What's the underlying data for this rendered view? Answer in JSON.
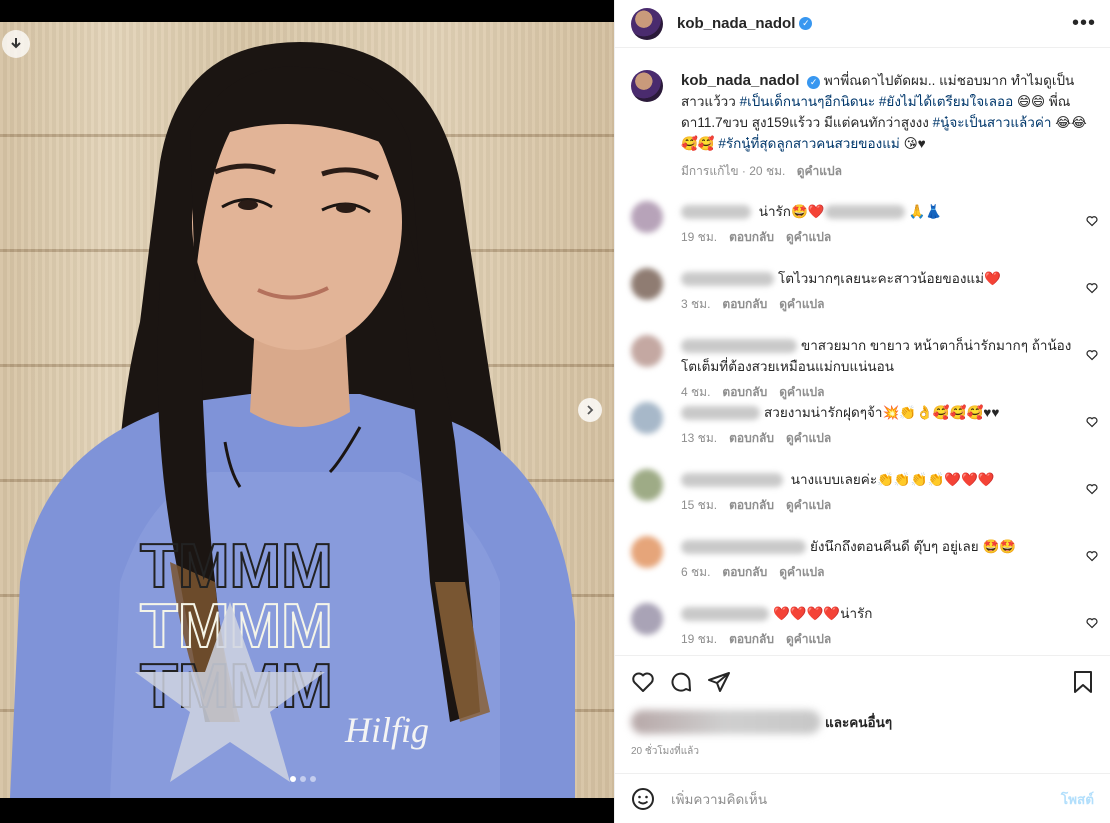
{
  "post": {
    "username": "kob_nada_nadol",
    "caption_text": "พาพี่ณดาไปตัดผม.. แม่ชอบมาก ทำไมดูเป็นสาวแว้วว ",
    "caption_tag1": "#เป็นเด็กนานๆอีกนิดนะ",
    "caption_tag2": "#ยังไม่ได้เตรียมใจเลออ",
    "caption_mid": " 😄😄 พี่ณดา11.7ขวบ สูง159แร้วว มีแต่คนทักว่าสูงงง ",
    "caption_tag3": "#นู๋จะเป็นสาวแล้วค่า",
    "caption_mid2": " 😂😂 🥰🥰 ",
    "caption_tag4": "#รักนู๋ที่สุดลูกสาวคนสวยของแม่",
    "caption_end": " 😘♥",
    "edited": "มีการแก้ไข · 20 ชม.",
    "translate": "ดูคำแปล"
  },
  "comments": [
    {
      "text": " น่ารัก🤩❤️",
      "tail": "🙏👗",
      "time": "19 ชม.",
      "reply": "ตอบกลับ",
      "translate": "ดูคำแปล",
      "avatar_color": "#b7a3b9"
    },
    {
      "text": "โตไวมากๆเลยนะคะสาวน้อยของแม่❤️",
      "tail": "",
      "time": "3 ชม.",
      "reply": "ตอบกลับ",
      "translate": "ดูคำแปล",
      "avatar_color": "#8f7c72"
    },
    {
      "text": "ขาสวยมาก ขายาว หน้าตาก็น่ารักมากๆ ถ้าน้องโตเต็มที่ต้องสวยเหมือนแม่กบแน่นอน",
      "tail": "",
      "time": "4 ชม.",
      "reply": "ตอบกลับ",
      "translate": "ดูคำแปล",
      "avatar_color": "#c4a8a2"
    },
    {
      "text": "สวยงามน่ารักฝุดๆจ้า💥👏👌🥰🥰🥰♥♥",
      "tail": "",
      "time": "13 ชม.",
      "reply": "ตอบกลับ",
      "translate": "ดูคำแปล",
      "avatar_color": "#a7b8c9"
    },
    {
      "text": " นางแบบเลยค่ะ👏👏👏👏❤️❤️❤️",
      "tail": "",
      "time": "15 ชม.",
      "reply": "ตอบกลับ",
      "translate": "ดูคำแปล",
      "avatar_color": "#9eab86"
    },
    {
      "text": "ยังนึกถึงตอนคีนดี ตุ๊บๆ อยู่เลย 🤩🤩",
      "tail": "",
      "time": "6 ชม.",
      "reply": "ตอบกลับ",
      "translate": "ดูคำแปล",
      "avatar_color": "#e6a57a"
    },
    {
      "text": "❤️❤️❤️❤️น่ารัก",
      "tail": "",
      "time": "19 ชม.",
      "reply": "ตอบกลับ",
      "translate": "ดูคำแปล",
      "avatar_color": "#a9a3b6"
    }
  ],
  "actions": {
    "likes_suffix": "และคนอื่นๆ",
    "posted_time": "20 ชั่วโมงที่แล้ว"
  },
  "composer": {
    "placeholder": "เพิ่มความคิดเห็น",
    "post_label": "โพสต์"
  },
  "colors": {
    "tag": "#00376b",
    "verified": "#3897f0",
    "post_button": "#b2dffc"
  },
  "icons": [
    "download-icon",
    "next-arrow-icon",
    "more-icon",
    "verified-icon",
    "heart-icon",
    "comment-icon",
    "share-icon",
    "bookmark-icon",
    "emoji-icon"
  ]
}
